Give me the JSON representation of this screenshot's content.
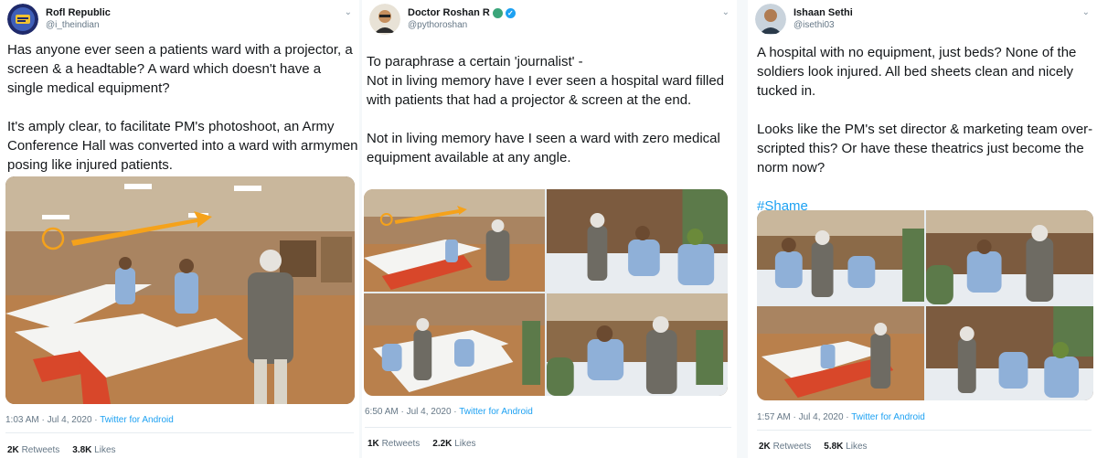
{
  "tweets": [
    {
      "display_name": "Rofl Republic",
      "handle": "@i_theindian",
      "avatar_icon": "rofl-republic-logo",
      "text": "Has anyone ever seen a patients ward with a projector, a screen & a headtable? A ward which doesn't have a single medical equipment?\n\nIt's amply clear, to facilitate PM's photoshoot, an Army Conference Hall was converted into a ward with armymen posing like injured patients.",
      "timestamp": "1:03 AM · Jul 4, 2020 · ",
      "source": "Twitter for Android",
      "retweets_count": "2K",
      "retweets_label": "Retweets",
      "likes_count": "3.8K",
      "likes_label": "Likes"
    },
    {
      "display_name": "Doctor Roshan R",
      "handle": "@pythoroshan",
      "avatar_icon": "person-avatar",
      "badges": [
        "globe-icon",
        "verified-icon"
      ],
      "text": "To paraphrase a certain 'journalist' -\nNot in living memory have I ever seen a hospital ward filled with patients that had a projector & screen at the end.\n\nNot in living memory have I seen a ward with zero medical equipment available at any angle.",
      "timestamp": "6:50 AM · Jul 4, 2020 · ",
      "source": "Twitter for Android",
      "retweets_count": "1K",
      "retweets_label": "Retweets",
      "likes_count": "2.2K",
      "likes_label": "Likes"
    },
    {
      "display_name": "Ishaan Sethi",
      "handle": "@isethi03",
      "avatar_icon": "person-avatar",
      "text": "A hospital with no equipment, just beds? None of the soldiers look injured. All bed sheets clean and nicely tucked in.\n\nLooks like the PM's set director & marketing team over-scripted this? Or have these theatrics just become the norm now?\n\n",
      "hashtag": "#Shame",
      "timestamp": "1:57 AM · Jul 4, 2020 · ",
      "source": "Twitter for Android",
      "retweets_count": "2K",
      "retweets_label": "Retweets",
      "likes_count": "5.8K",
      "likes_label": "Likes"
    }
  ],
  "colors": {
    "link": "#1da1f2",
    "secondary_text": "#657786",
    "bed_sheet": "#f4f4f2",
    "blanket_red": "#d8472a",
    "arrow_orange": "#f5a21b",
    "wall": "#b08a64",
    "floor": "#b9804c"
  }
}
